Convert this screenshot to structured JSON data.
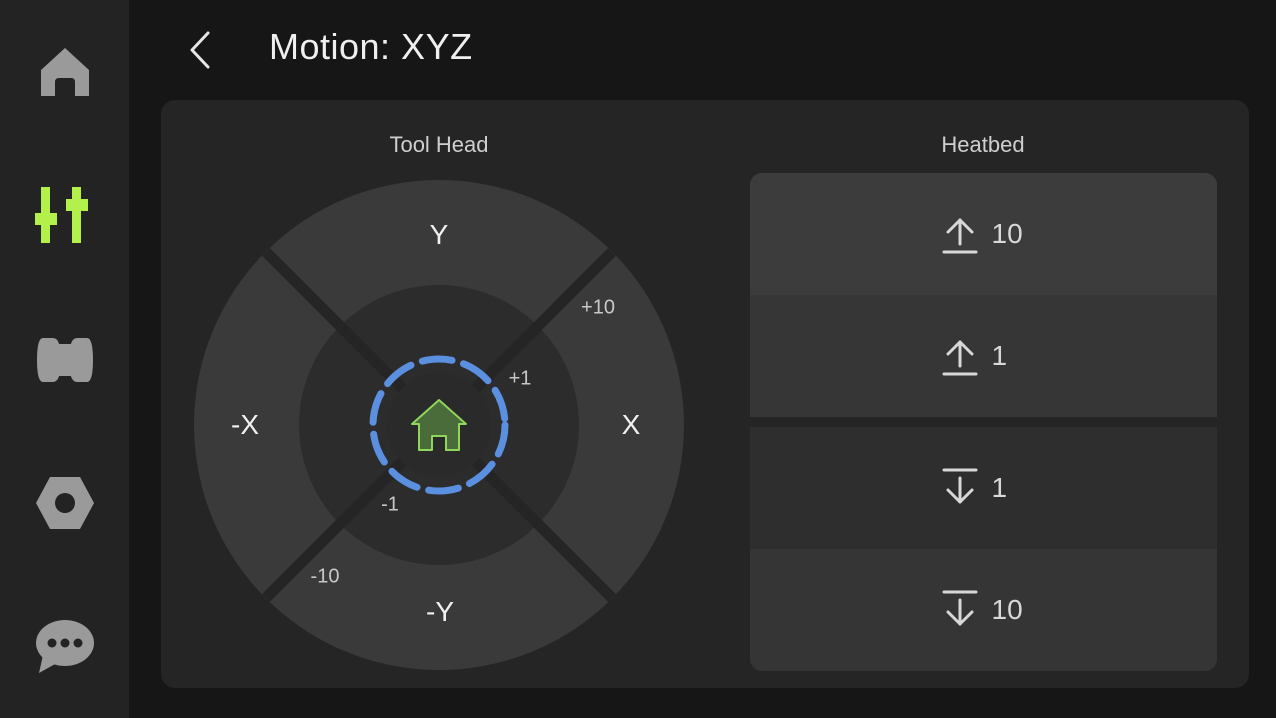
{
  "sidebar": {
    "items": [
      {
        "icon": "home-icon",
        "active": false
      },
      {
        "icon": "sliders-icon",
        "active": true
      },
      {
        "icon": "filament-spool-icon",
        "active": false
      },
      {
        "icon": "hex-nut-settings-icon",
        "active": false
      },
      {
        "icon": "chat-bubble-icon",
        "active": false
      }
    ],
    "active_color": "#b4f04c",
    "inactive_color": "#9a9a9a"
  },
  "header": {
    "title": "Motion: XYZ",
    "back_icon": "chevron-left-icon"
  },
  "toolhead": {
    "title": "Tool Head",
    "axes": {
      "y_plus": "Y",
      "y_minus": "-Y",
      "x_plus": "X",
      "x_minus": "-X"
    },
    "steps": {
      "plus10": "+10",
      "plus1": "+1",
      "minus1": "-1",
      "minus10": "-10"
    },
    "home_icon": "home-icon",
    "home_icon_color": "#7ec84a",
    "ring_color": "#5b8fe0"
  },
  "heatbed": {
    "title": "Heatbed",
    "buttons": [
      {
        "direction": "up",
        "icon": "arrow-up-to-line-icon",
        "value": "10"
      },
      {
        "direction": "up",
        "icon": "arrow-up-to-line-icon",
        "value": "1"
      },
      {
        "direction": "down",
        "icon": "arrow-down-from-line-icon",
        "value": "1"
      },
      {
        "direction": "down",
        "icon": "arrow-down-from-line-icon",
        "value": "10"
      }
    ]
  }
}
